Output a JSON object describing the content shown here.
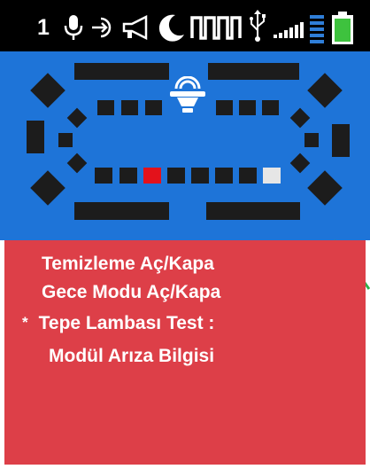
{
  "statusbar": {
    "notification_count": "1",
    "icons": [
      "microphone-icon",
      "login-icon",
      "megaphone-icon",
      "moon-icon",
      "pulse-wave-icon",
      "usb-icon",
      "signal-icon",
      "sd-card-icon",
      "battery-icon"
    ]
  },
  "panel": {
    "active_lamp_color": "#e3121b",
    "selected_lamp_color": "#e6e6e6"
  },
  "menu": {
    "items": [
      {
        "marker": "",
        "label": "Temizleme Aç/Kapa"
      },
      {
        "marker": "",
        "label": "Gece Modu Aç/Kapa"
      },
      {
        "marker": "*",
        "label": "Tepe Lambası Test :"
      },
      {
        "marker": "",
        "label": "Modül Arıza Bilgisi"
      }
    ]
  },
  "colors": {
    "panel_bg": "#1e74d8",
    "menu_bg": "#dd3f48",
    "statusbar_bg": "#000000",
    "arrow": "#2db04b"
  }
}
